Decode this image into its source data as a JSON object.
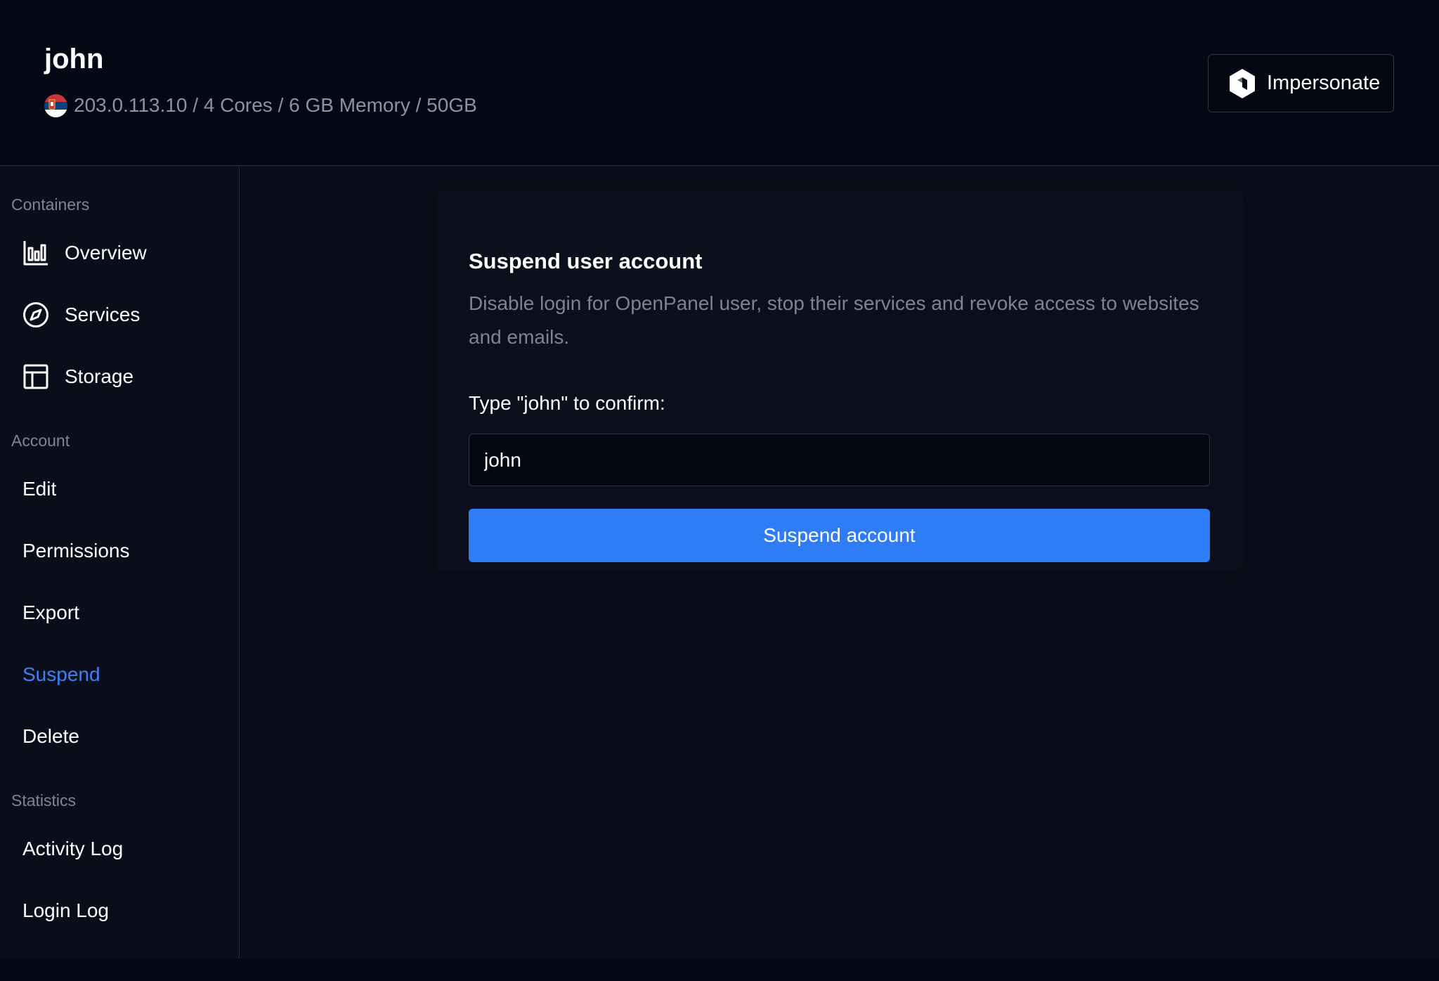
{
  "header": {
    "user_name": "john",
    "flag_icon": "serbia-flag-icon",
    "specs": "203.0.113.10 / 4 Cores / 6 GB Memory / 50GB",
    "impersonate_label": "Impersonate",
    "impersonate_icon": "cube-icon"
  },
  "sidebar": {
    "sections": [
      {
        "label": "Containers",
        "items": [
          {
            "label": "Overview",
            "icon": "bar-chart-icon"
          },
          {
            "label": "Services",
            "icon": "compass-icon"
          },
          {
            "label": "Storage",
            "icon": "table-icon"
          }
        ]
      },
      {
        "label": "Account",
        "items": [
          {
            "label": "Edit"
          },
          {
            "label": "Permissions"
          },
          {
            "label": "Export"
          },
          {
            "label": "Suspend",
            "active": true
          },
          {
            "label": "Delete"
          }
        ]
      },
      {
        "label": "Statistics",
        "items": [
          {
            "label": "Activity Log"
          },
          {
            "label": "Login Log"
          }
        ]
      }
    ]
  },
  "card": {
    "title": "Suspend user account",
    "description": "Disable login for OpenPanel user, stop their services and revoke access to websites and emails.",
    "confirm_label": "Type \"john\" to confirm:",
    "confirm_value": "john",
    "submit_label": "Suspend account"
  },
  "colors": {
    "accent": "#2f7df6",
    "active_nav": "#3b82f6",
    "background": "#0a0e1a",
    "header_bg": "#040814"
  }
}
